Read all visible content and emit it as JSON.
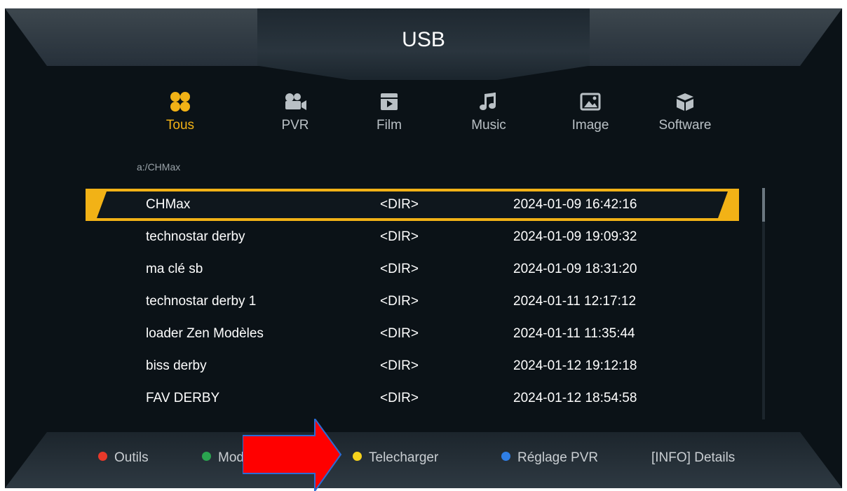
{
  "header": {
    "title": "USB"
  },
  "tabs": [
    {
      "label": "Tous",
      "icon": "grid-icon",
      "active": true
    },
    {
      "label": "PVR",
      "icon": "camcorder-icon",
      "active": false
    },
    {
      "label": "Film",
      "icon": "film-icon",
      "active": false
    },
    {
      "label": "Music",
      "icon": "music-note-icon",
      "active": false
    },
    {
      "label": "Image",
      "icon": "picture-icon",
      "active": false
    },
    {
      "label": "Software",
      "icon": "box-icon",
      "active": false
    }
  ],
  "path": "a:/CHMax",
  "files": [
    {
      "name": "CHMax",
      "type": "<DIR>",
      "date": "2024-01-09 16:42:16"
    },
    {
      "name": "technostar derby",
      "type": "<DIR>",
      "date": "2024-01-09 19:09:32"
    },
    {
      "name": "ma clé sb",
      "type": "<DIR>",
      "date": "2024-01-09 18:31:20"
    },
    {
      "name": "technostar derby 1",
      "type": "<DIR>",
      "date": "2024-01-11 12:17:12"
    },
    {
      "name": "loader Zen Modèles",
      "type": "<DIR>",
      "date": "2024-01-11 11:35:44"
    },
    {
      "name": "biss derby",
      "type": "<DIR>",
      "date": "2024-01-12 19:12:18"
    },
    {
      "name": "FAV DERBY",
      "type": "<DIR>",
      "date": "2024-01-12 18:54:58"
    }
  ],
  "footer": {
    "red": "Outils",
    "green": "Mode a",
    "yellow": "Telecharger",
    "blue": "Réglage PVR",
    "info": "[INFO] Details"
  },
  "colors": {
    "accent": "#f2b216",
    "red": "#e8392a",
    "green": "#2aa44f",
    "yellow": "#f5d21c",
    "blue": "#2f7fe6",
    "annotation_arrow": "#ff0000"
  }
}
